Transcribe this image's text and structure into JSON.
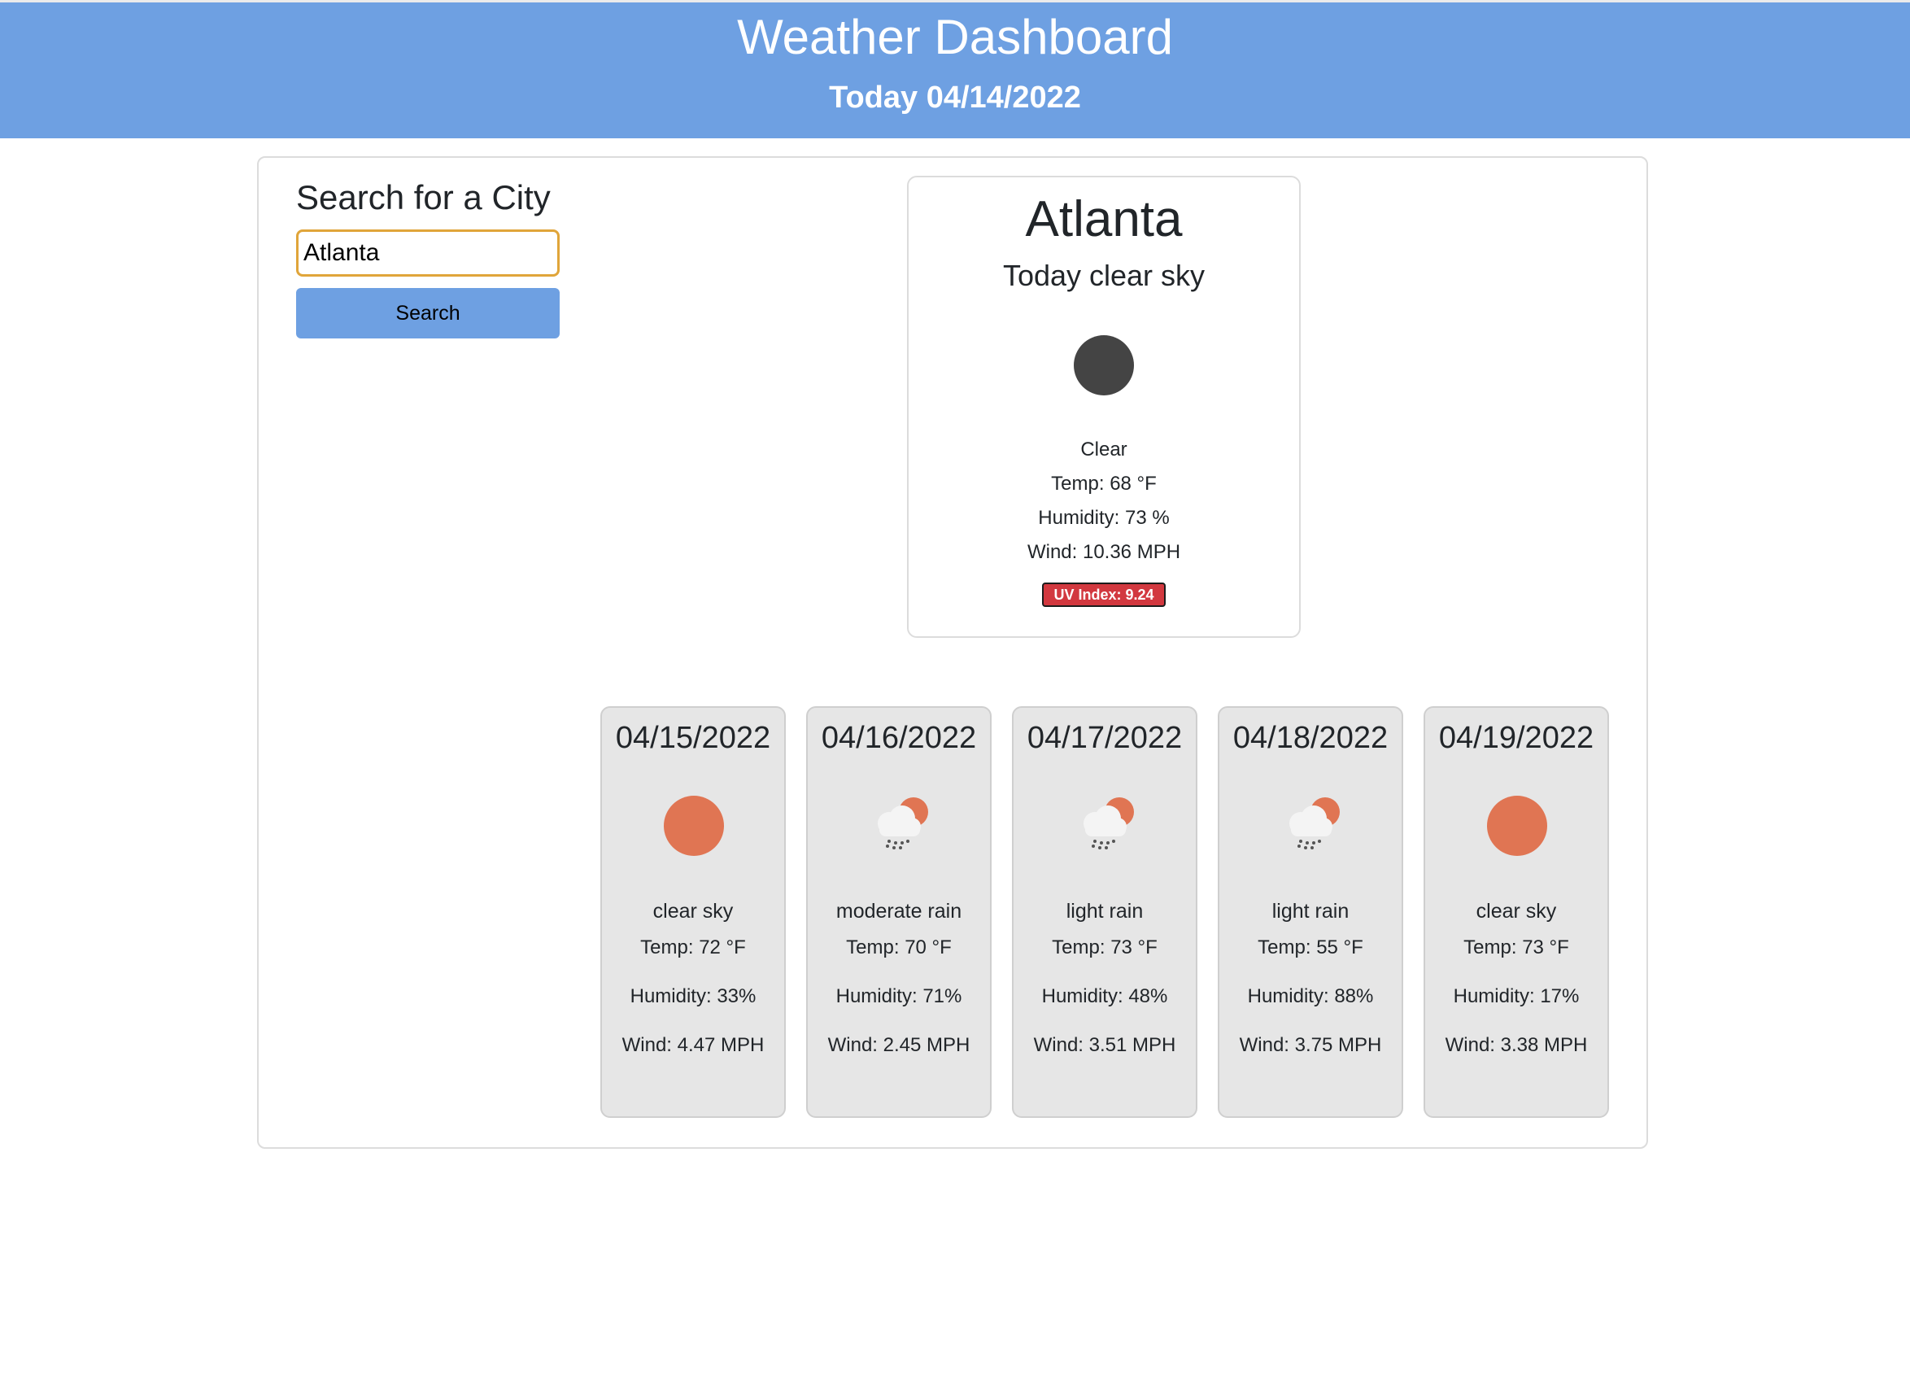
{
  "header": {
    "title": "Weather Dashboard",
    "subtitle": "Today 04/14/2022"
  },
  "search": {
    "heading": "Search for a City",
    "input_value": "Atlanta",
    "button_label": "Search"
  },
  "today": {
    "city": "Atlanta",
    "description": "Today clear sky",
    "icon": "clear-sky-night-icon",
    "condition": "Clear",
    "temp": "Temp: 68 °F",
    "humidity": "Humidity: 73 %",
    "wind": "Wind: 10.36 MPH",
    "uv": "UV Index: 9.24",
    "uv_color": "#d2383f"
  },
  "forecast": [
    {
      "date": "04/15/2022",
      "icon": "sun-icon",
      "desc": "clear sky",
      "temp": "Temp: 72 °F",
      "humidity": "Humidity: 33%",
      "wind": "Wind: 4.47 MPH"
    },
    {
      "date": "04/16/2022",
      "icon": "rain-icon",
      "desc": "moderate rain",
      "temp": "Temp: 70 °F",
      "humidity": "Humidity: 71%",
      "wind": "Wind: 2.45 MPH"
    },
    {
      "date": "04/17/2022",
      "icon": "rain-icon",
      "desc": "light rain",
      "temp": "Temp: 73 °F",
      "humidity": "Humidity: 48%",
      "wind": "Wind: 3.51 MPH"
    },
    {
      "date": "04/18/2022",
      "icon": "rain-icon",
      "desc": "light rain",
      "temp": "Temp: 55 °F",
      "humidity": "Humidity: 88%",
      "wind": "Wind: 3.75 MPH"
    },
    {
      "date": "04/19/2022",
      "icon": "sun-icon",
      "desc": "clear sky",
      "temp": "Temp: 73 °F",
      "humidity": "Humidity: 17%",
      "wind": "Wind: 3.38 MPH"
    }
  ],
  "colors": {
    "header_bg": "#6ea0e2",
    "button_bg": "#6ea0e2",
    "card_bg": "#e6e6e6",
    "sun": "#e07553",
    "night_icon": "#444444"
  }
}
